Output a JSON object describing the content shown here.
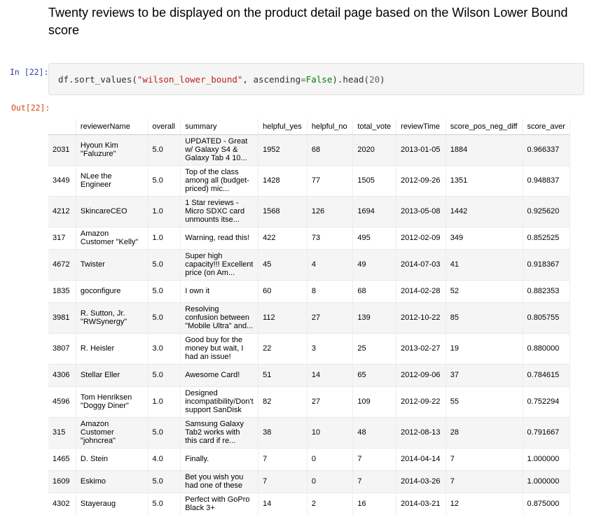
{
  "markdown": {
    "heading": "Twenty reviews to be displayed on the product detail page based on the Wilson Lower Bound score"
  },
  "input_cell": {
    "prompt": "In [22]:",
    "code": {
      "p1": "df.sort_values(",
      "s1": "\"wilson_lower_bound\"",
      "p2": ", ascending",
      "eq": "=",
      "kw": "False",
      "p3": ").head(",
      "num": "20",
      "p4": ")"
    }
  },
  "output_cell": {
    "prompt": "Out[22]:",
    "columns": [
      "",
      "reviewerName",
      "overall",
      "summary",
      "helpful_yes",
      "helpful_no",
      "total_vote",
      "reviewTime",
      "score_pos_neg_diff",
      "score_aver"
    ],
    "rows": [
      {
        "idx": "2031",
        "name": "Hyoun Kim \"Faluzure\"",
        "overall": "5.0",
        "summary": "UPDATED - Great w/ Galaxy S4 & Galaxy Tab 4 10...",
        "yes": "1952",
        "no": "68",
        "total": "2020",
        "time": "2013-01-05",
        "diff": "1884",
        "aver": "0.966337"
      },
      {
        "idx": "3449",
        "name": "NLee the Engineer",
        "overall": "5.0",
        "summary": "Top of the class among all (budget-priced) mic...",
        "yes": "1428",
        "no": "77",
        "total": "1505",
        "time": "2012-09-26",
        "diff": "1351",
        "aver": "0.948837"
      },
      {
        "idx": "4212",
        "name": "SkincareCEO",
        "overall": "1.0",
        "summary": "1 Star reviews - Micro SDXC card unmounts itse...",
        "yes": "1568",
        "no": "126",
        "total": "1694",
        "time": "2013-05-08",
        "diff": "1442",
        "aver": "0.925620"
      },
      {
        "idx": "317",
        "name": "Amazon Customer \"Kelly\"",
        "overall": "1.0",
        "summary": "Warning, read this!",
        "yes": "422",
        "no": "73",
        "total": "495",
        "time": "2012-02-09",
        "diff": "349",
        "aver": "0.852525"
      },
      {
        "idx": "4672",
        "name": "Twister",
        "overall": "5.0",
        "summary": "Super high capacity!!! Excellent price (on Am...",
        "yes": "45",
        "no": "4",
        "total": "49",
        "time": "2014-07-03",
        "diff": "41",
        "aver": "0.918367"
      },
      {
        "idx": "1835",
        "name": "goconfigure",
        "overall": "5.0",
        "summary": "I own it",
        "yes": "60",
        "no": "8",
        "total": "68",
        "time": "2014-02-28",
        "diff": "52",
        "aver": "0.882353"
      },
      {
        "idx": "3981",
        "name": "R. Sutton, Jr. \"RWSynergy\"",
        "overall": "5.0",
        "summary": "Resolving confusion between \"Mobile Ultra\" and...",
        "yes": "112",
        "no": "27",
        "total": "139",
        "time": "2012-10-22",
        "diff": "85",
        "aver": "0.805755"
      },
      {
        "idx": "3807",
        "name": "R. Heisler",
        "overall": "3.0",
        "summary": "Good buy for the money but wait, I had an issue!",
        "yes": "22",
        "no": "3",
        "total": "25",
        "time": "2013-02-27",
        "diff": "19",
        "aver": "0.880000"
      },
      {
        "idx": "4306",
        "name": "Stellar Eller",
        "overall": "5.0",
        "summary": "Awesome Card!",
        "yes": "51",
        "no": "14",
        "total": "65",
        "time": "2012-09-06",
        "diff": "37",
        "aver": "0.784615"
      },
      {
        "idx": "4596",
        "name": "Tom Henriksen \"Doggy Diner\"",
        "overall": "1.0",
        "summary": "Designed incompatibility/Don't support SanDisk",
        "yes": "82",
        "no": "27",
        "total": "109",
        "time": "2012-09-22",
        "diff": "55",
        "aver": "0.752294"
      },
      {
        "idx": "315",
        "name": "Amazon Customer \"johncrea\"",
        "overall": "5.0",
        "summary": "Samsung Galaxy Tab2 works with this card if re...",
        "yes": "38",
        "no": "10",
        "total": "48",
        "time": "2012-08-13",
        "diff": "28",
        "aver": "0.791667"
      },
      {
        "idx": "1465",
        "name": "D. Stein",
        "overall": "4.0",
        "summary": "Finally.",
        "yes": "7",
        "no": "0",
        "total": "7",
        "time": "2014-04-14",
        "diff": "7",
        "aver": "1.000000"
      },
      {
        "idx": "1609",
        "name": "Eskimo",
        "overall": "5.0",
        "summary": "Bet you wish you had one of these",
        "yes": "7",
        "no": "0",
        "total": "7",
        "time": "2014-03-26",
        "diff": "7",
        "aver": "1.000000"
      },
      {
        "idx": "4302",
        "name": "Stayeraug",
        "overall": "5.0",
        "summary": "Perfect with GoPro Black 3+",
        "yes": "14",
        "no": "2",
        "total": "16",
        "time": "2014-03-21",
        "diff": "12",
        "aver": "0.875000"
      }
    ]
  }
}
